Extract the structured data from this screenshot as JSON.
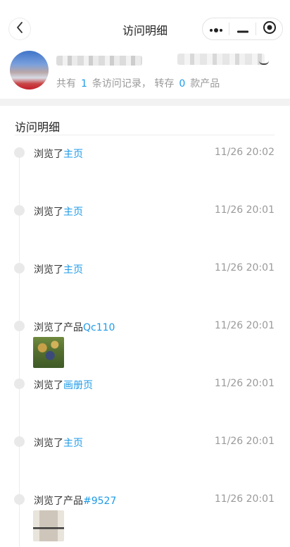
{
  "navbar": {
    "title": "访问明细"
  },
  "profile": {
    "stats_prefix": "共有",
    "visit_count": "1",
    "visit_label": "条访问记录，",
    "transfer_prefix": "转存",
    "transfer_count": "0",
    "transfer_label": "款产品"
  },
  "section": {
    "title": "访问明细"
  },
  "entries": [
    {
      "action": "浏览了",
      "target": "主页",
      "time": "11/26 20:02"
    },
    {
      "action": "浏览了",
      "target": "主页",
      "time": "11/26 20:01"
    },
    {
      "action": "浏览了",
      "target": "主页",
      "time": "11/26 20:01"
    },
    {
      "action": "浏览了产品",
      "target": "Qc110",
      "time": "11/26 20:01"
    },
    {
      "action": "浏览了",
      "target": "画册页",
      "time": "11/26 20:01"
    },
    {
      "action": "浏览了",
      "target": "主页",
      "time": "11/26 20:01"
    },
    {
      "action": "浏览了产品",
      "target": "#9527",
      "time": "11/26 20:01"
    }
  ],
  "colors": {
    "accent": "#1e9be8",
    "muted": "#999999",
    "timeline_dot": "#e9e9e9"
  },
  "icons": {
    "back": "back-arrow-icon",
    "more": "more-dots-icon",
    "minimize": "minimize-icon",
    "close": "target-circle-icon"
  }
}
